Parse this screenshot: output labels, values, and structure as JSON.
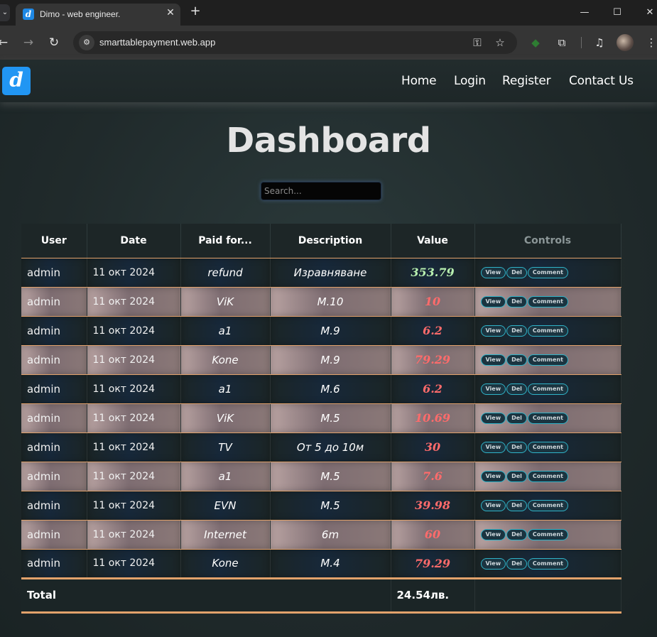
{
  "browser": {
    "tab_title": "Dimo - web engineer.",
    "url": "smarttablepayment.web.app",
    "favicon_letter": "d"
  },
  "icons": {
    "tab_list": "chevron-down-icon",
    "close": "close-icon",
    "new_tab": "plus-icon",
    "back": "back-arrow-icon",
    "forward": "forward-arrow-icon",
    "reload": "reload-icon",
    "site_info": "tune-icon",
    "password": "key-icon",
    "bookmark": "star-icon",
    "extension_green": "puzzle-green-icon",
    "extensions": "puzzle-icon",
    "media": "media-queue-icon",
    "menu": "three-dots-icon"
  },
  "site": {
    "logo_letter": "d",
    "nav": [
      "Home",
      "Login",
      "Register",
      "Contact Us"
    ],
    "title": "Dashboard",
    "search_placeholder": "Search..."
  },
  "colors": {
    "accent_line": "#e2a26b",
    "value_negative": "#ff6b6b",
    "value_positive": "#b8f0b0",
    "logo_blue": "#2196f3",
    "control_border": "#2fb3c8"
  },
  "table": {
    "headers": [
      "User",
      "Date",
      "Paid for...",
      "Description",
      "Value",
      "Controls"
    ],
    "control_labels": [
      "View",
      "Del",
      "Comment"
    ],
    "rows": [
      {
        "user": "admin",
        "date": "11 окт 2024",
        "paid": "refund",
        "desc": "Изравняване",
        "value": "353.79",
        "sign": "pos"
      },
      {
        "user": "admin",
        "date": "11 окт 2024",
        "paid": "ViK",
        "desc": "M.10",
        "value": "10",
        "sign": "neg"
      },
      {
        "user": "admin",
        "date": "11 окт 2024",
        "paid": "a1",
        "desc": "M.9",
        "value": "6.2",
        "sign": "neg"
      },
      {
        "user": "admin",
        "date": "11 окт 2024",
        "paid": "Kone",
        "desc": "M.9",
        "value": "79.29",
        "sign": "neg"
      },
      {
        "user": "admin",
        "date": "11 окт 2024",
        "paid": "a1",
        "desc": "M.6",
        "value": "6.2",
        "sign": "neg"
      },
      {
        "user": "admin",
        "date": "11 окт 2024",
        "paid": "ViK",
        "desc": "M.5",
        "value": "10.69",
        "sign": "neg"
      },
      {
        "user": "admin",
        "date": "11 окт 2024",
        "paid": "TV",
        "desc": "От 5 до 10м",
        "value": "30",
        "sign": "neg"
      },
      {
        "user": "admin",
        "date": "11 окт 2024",
        "paid": "a1",
        "desc": "M.5",
        "value": "7.6",
        "sign": "neg"
      },
      {
        "user": "admin",
        "date": "11 окт 2024",
        "paid": "EVN",
        "desc": "M.5",
        "value": "39.98",
        "sign": "neg"
      },
      {
        "user": "admin",
        "date": "11 окт 2024",
        "paid": "Internet",
        "desc": "6m",
        "value": "60",
        "sign": "neg"
      },
      {
        "user": "admin",
        "date": "11 окт 2024",
        "paid": "Kone",
        "desc": "M.4",
        "value": "79.29",
        "sign": "neg"
      }
    ],
    "total_label": "Total",
    "total_value": "24.54лв."
  }
}
